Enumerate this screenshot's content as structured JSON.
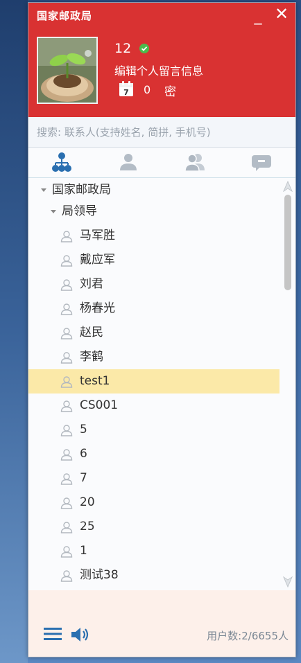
{
  "app": {
    "title": "国家邮政局",
    "minimize_glyph": "_",
    "close_glyph": "✕"
  },
  "profile": {
    "user_id": "12",
    "status": "online",
    "signature": "编辑个人留言信息",
    "calendar_count": "0",
    "lock_label": "密",
    "calendar_day": "7"
  },
  "search": {
    "placeholder": "搜索: 联系人(支持姓名, 简拼, 手机号)",
    "value": ""
  },
  "tabs": [
    {
      "name": "org",
      "icon": "org-tree-icon",
      "active": true
    },
    {
      "name": "contacts",
      "icon": "person-icon",
      "active": false
    },
    {
      "name": "groups",
      "icon": "group-icon",
      "active": false
    },
    {
      "name": "messages",
      "icon": "message-icon",
      "active": false
    }
  ],
  "tree": {
    "root": "国家邮政局",
    "group": "局领导",
    "members": [
      "马军胜",
      "戴应军",
      "刘君",
      "杨春光",
      "赵民",
      "李鹤",
      "test1",
      "CS001",
      "5",
      "6",
      "7",
      "20",
      "25",
      "1",
      "测试38"
    ],
    "selected": "test1"
  },
  "footer": {
    "user_count": "用户数:2/6655人"
  },
  "colors": {
    "header_bg": "#d93232",
    "accent_blue": "#2a6fb0",
    "selected_row": "#fbe9a8",
    "status_green": "#4cbb4c"
  }
}
